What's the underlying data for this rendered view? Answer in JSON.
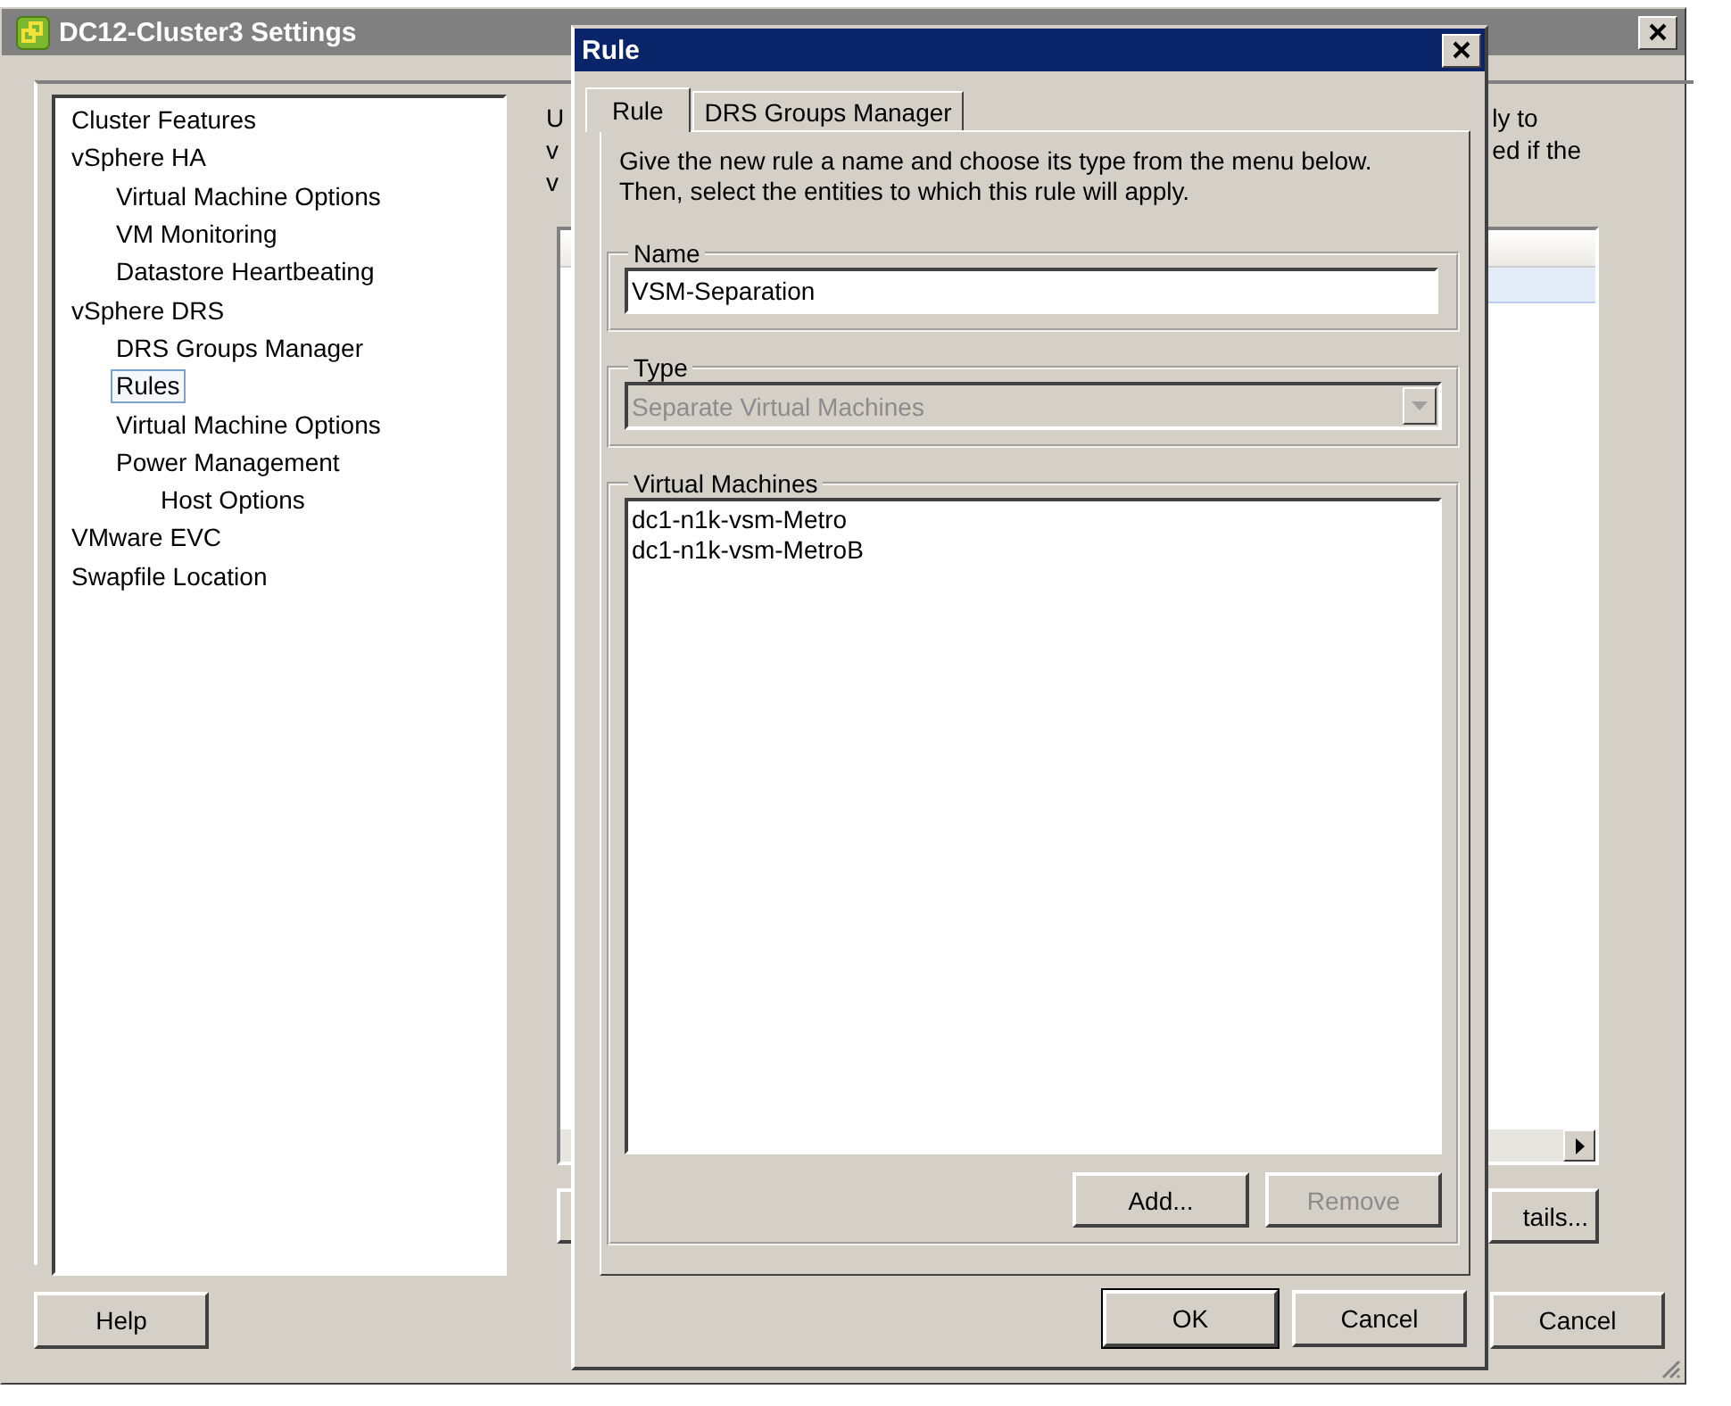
{
  "window": {
    "title": "DC12-Cluster3 Settings"
  },
  "sidebar": {
    "items": [
      {
        "label": "Cluster Features",
        "selected": false
      },
      {
        "label": "vSphere HA",
        "selected": false,
        "children": [
          {
            "label": "Virtual Machine Options",
            "selected": false
          },
          {
            "label": "VM Monitoring",
            "selected": false
          },
          {
            "label": "Datastore Heartbeating",
            "selected": false
          }
        ]
      },
      {
        "label": "vSphere DRS",
        "selected": false,
        "children": [
          {
            "label": "DRS Groups Manager",
            "selected": false
          },
          {
            "label": "Rules",
            "selected": true
          },
          {
            "label": "Virtual Machine Options",
            "selected": false
          },
          {
            "label": "Power Management",
            "selected": false,
            "children": [
              {
                "label": "Host Options",
                "selected": false
              }
            ]
          }
        ]
      },
      {
        "label": "VMware EVC",
        "selected": false
      },
      {
        "label": "Swapfile Location",
        "selected": false
      }
    ]
  },
  "background_panel": {
    "description_left": [
      "U",
      "v",
      "v"
    ],
    "description_right": [
      "ly to",
      "ed if the"
    ],
    "details_button": "tails..."
  },
  "footer_buttons": [
    "Help",
    "Cancel"
  ],
  "dialog": {
    "title": "Rule",
    "tabs": [
      {
        "label": "Rule",
        "selected": true
      },
      {
        "label": "DRS Groups Manager",
        "selected": false
      }
    ],
    "instructions": "Give the new rule a name and choose its type from the menu below.\nThen, select the entities to which this rule will apply.",
    "name": {
      "label": "Name",
      "value": "VSM-Separation"
    },
    "type": {
      "label": "Type",
      "value": "Separate Virtual Machines",
      "disabled": true
    },
    "virtual_machines": {
      "label": "Virtual Machines",
      "items": [
        "dc1-n1k-vsm-Metro",
        "dc1-n1k-vsm-MetroB"
      ]
    },
    "list_buttons": [
      {
        "label": "Add...",
        "disabled": false
      },
      {
        "label": "Remove",
        "disabled": true
      }
    ],
    "buttons": [
      {
        "label": "OK",
        "default": true
      },
      {
        "label": "Cancel",
        "default": false
      }
    ]
  }
}
